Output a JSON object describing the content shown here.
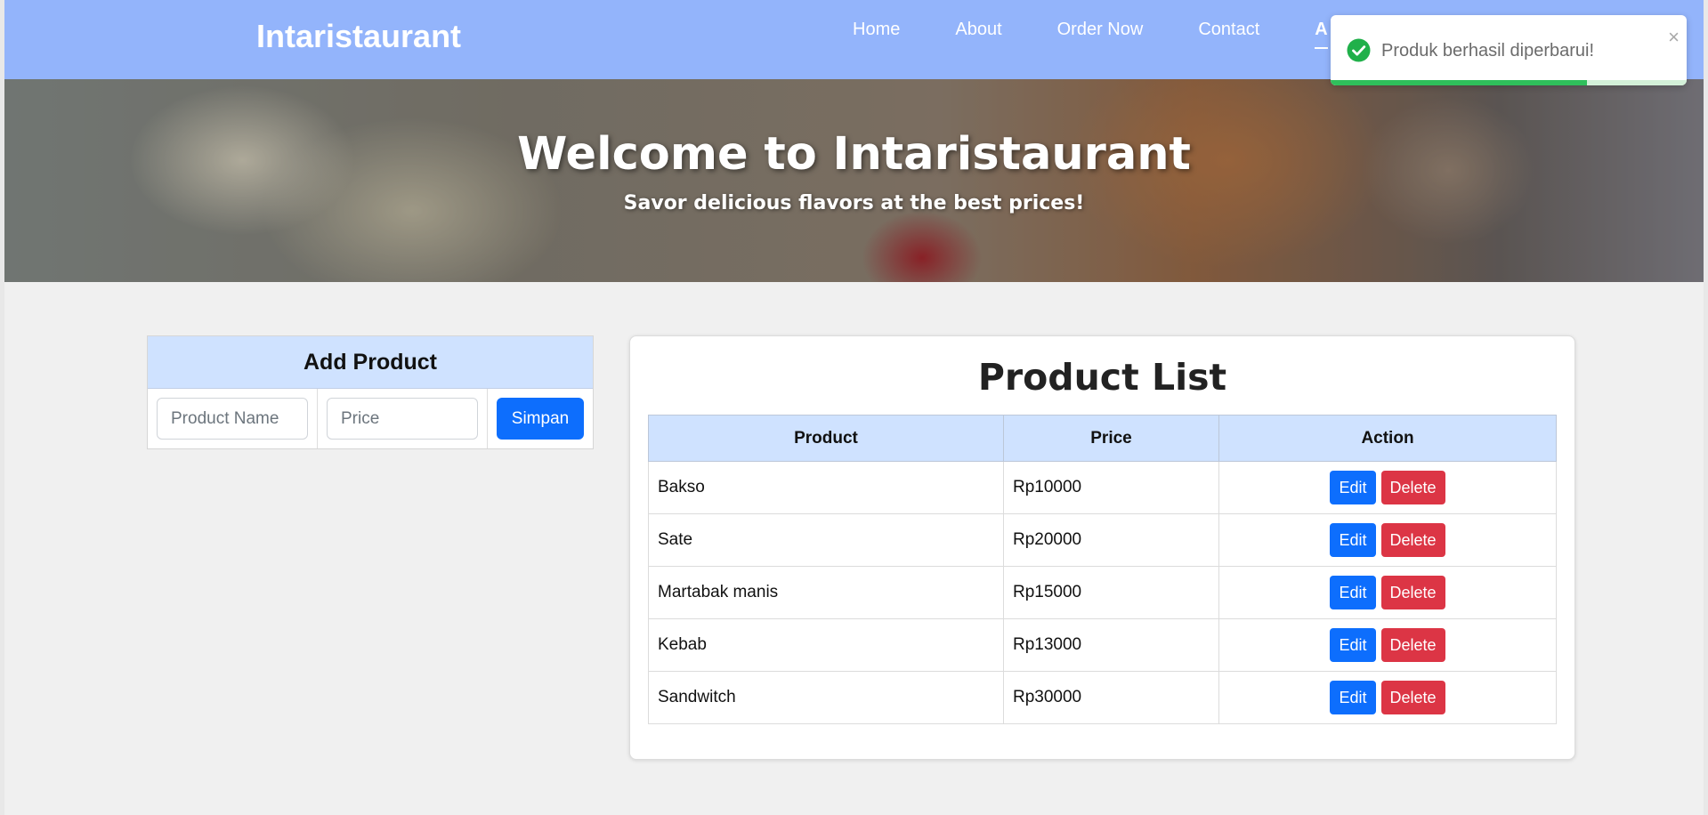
{
  "navbar": {
    "brand": "Intaristaurant",
    "links": [
      "Home",
      "About",
      "Order Now",
      "Contact",
      "A"
    ]
  },
  "hero": {
    "title": "Welcome to Intaristaurant",
    "subtitle": "Savor delicious flavors at the best prices!"
  },
  "add_product": {
    "heading": "Add Product",
    "name_placeholder": "Product Name",
    "price_placeholder": "Price",
    "save_label": "Simpan"
  },
  "product_list": {
    "title": "Product List",
    "columns": [
      "Product",
      "Price",
      "Action"
    ],
    "rows": [
      {
        "product": "Bakso",
        "price": "Rp10000"
      },
      {
        "product": "Sate",
        "price": "Rp20000"
      },
      {
        "product": "Martabak manis",
        "price": "Rp15000"
      },
      {
        "product": "Kebab",
        "price": "Rp13000"
      },
      {
        "product": "Sandwitch",
        "price": "Rp30000"
      }
    ],
    "edit_label": "Edit",
    "delete_label": "Delete"
  },
  "toast": {
    "message": "Produk berhasil diperbarui!",
    "close_symbol": "×",
    "icon": "check-circle-icon",
    "progress": 0.72
  },
  "colors": {
    "navbar": "#93b4fb",
    "header_blue": "#cfe2ff",
    "primary": "#0d6efd",
    "danger": "#dc3545",
    "success": "#2fbf5b"
  }
}
